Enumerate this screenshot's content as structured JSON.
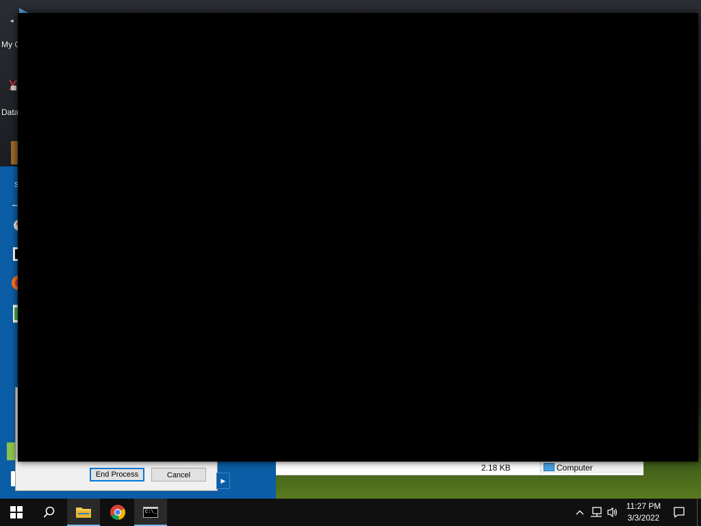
{
  "desktop": {
    "icons": [
      {
        "label": "My C"
      },
      {
        "label": "Data"
      }
    ]
  },
  "explorer": {
    "file_size": "2.18 KB",
    "location": "Computer"
  },
  "dialog": {
    "end_process_label": "End Process",
    "cancel_label": "Cancel"
  },
  "start_menu": {
    "letter": "S"
  },
  "taskbar": {
    "time": "11:27 PM",
    "date": "3/3/2022",
    "apps": [
      "file-explorer",
      "chrome",
      "command-prompt"
    ],
    "cmd_icon_text": "C:\\_"
  },
  "colors": {
    "start_menu_blue": "#0b5ea6",
    "taskbar": "#101010",
    "active_underline": "#76b9ed",
    "dialog_default_border": "#0078d7"
  }
}
